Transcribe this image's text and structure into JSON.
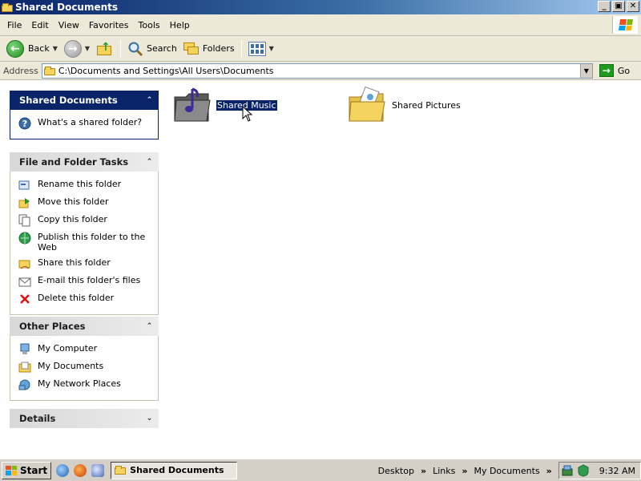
{
  "window": {
    "title": "Shared Documents",
    "buttons": [
      "minimize",
      "maximize",
      "close"
    ],
    "button_glyphs": {
      "minimize": "_",
      "maximize": "▣",
      "close": "✕"
    }
  },
  "menubar": {
    "items": [
      "File",
      "Edit",
      "View",
      "Favorites",
      "Tools",
      "Help"
    ]
  },
  "toolbar": {
    "back_label": "Back",
    "search_label": "Search",
    "folders_label": "Folders"
  },
  "address": {
    "label": "Address",
    "value": "C:\\Documents and Settings\\All Users\\Documents",
    "go_label": "Go"
  },
  "left_pane": {
    "shared_docs_panel": {
      "title": "Shared Documents",
      "items": [
        {
          "label": "What's a shared folder?",
          "icon": "help-icon"
        }
      ]
    },
    "file_tasks_panel": {
      "title": "File and Folder Tasks",
      "items": [
        {
          "label": "Rename this folder",
          "icon": "rename-icon"
        },
        {
          "label": "Move this folder",
          "icon": "move-icon"
        },
        {
          "label": "Copy this folder",
          "icon": "copy-icon"
        },
        {
          "label": "Publish this folder to the Web",
          "icon": "publish-web-icon"
        },
        {
          "label": "Share this folder",
          "icon": "share-icon"
        },
        {
          "label": "E-mail this folder's files",
          "icon": "email-icon"
        },
        {
          "label": "Delete this folder",
          "icon": "delete-icon"
        }
      ]
    },
    "other_places_panel": {
      "title": "Other Places",
      "items": [
        {
          "label": "My Computer",
          "icon": "my-computer-icon"
        },
        {
          "label": "My Documents",
          "icon": "my-documents-icon"
        },
        {
          "label": "My Network Places",
          "icon": "network-places-icon"
        }
      ]
    },
    "details_panel": {
      "title": "Details"
    }
  },
  "main": {
    "items": [
      {
        "name": "Shared Music",
        "icon": "music-folder-icon",
        "selected": true
      },
      {
        "name": "Shared Pictures",
        "icon": "pictures-folder-icon",
        "selected": false
      }
    ]
  },
  "taskbar": {
    "start_label": "Start",
    "active_window_label": "Shared Documents",
    "toolbars": [
      "Desktop",
      "Links",
      "My Documents"
    ],
    "clock": "9:32 AM"
  },
  "colors": {
    "title_bar": "#0a246a",
    "selection": "#0a246a",
    "panel_header_blue": "#0a246a",
    "folder_yellow": "#f4d35e"
  }
}
